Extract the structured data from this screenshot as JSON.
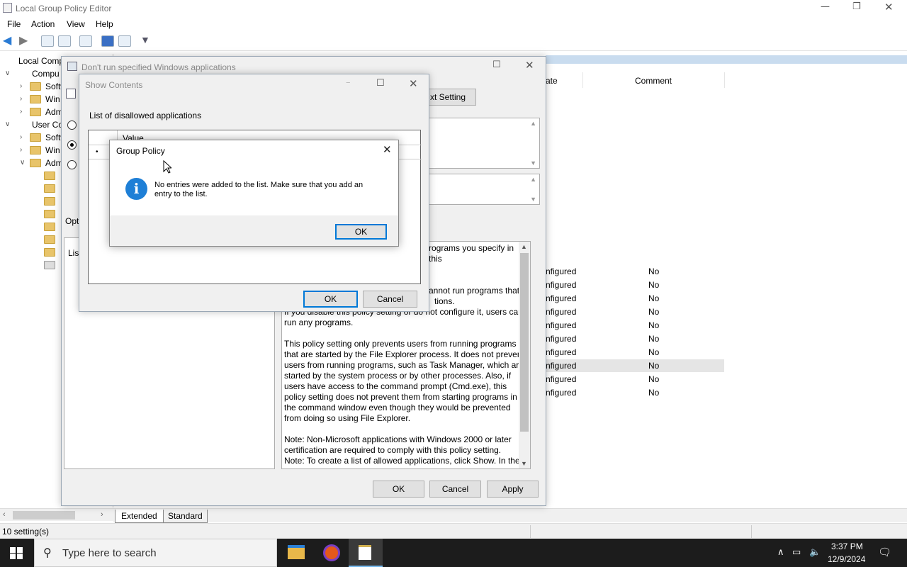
{
  "main": {
    "title": "Local Group Policy Editor",
    "menu": [
      "File",
      "Action",
      "View",
      "Help"
    ],
    "tree": [
      {
        "label": "Local Comp",
        "indent": 0
      },
      {
        "label": "Compu",
        "indent": 1
      },
      {
        "label": "Softw",
        "indent": 2
      },
      {
        "label": "Win",
        "indent": 2
      },
      {
        "label": "Adm",
        "indent": 2
      },
      {
        "label": "User Co",
        "indent": 1
      },
      {
        "label": "Softw",
        "indent": 2
      },
      {
        "label": "Win",
        "indent": 2
      },
      {
        "label": "Adm",
        "indent": 2
      }
    ],
    "columns": {
      "state": "ate",
      "comment": "Comment"
    },
    "rows": [
      {
        "state": "nfigured",
        "comment": "No"
      },
      {
        "state": "nfigured",
        "comment": "No"
      },
      {
        "state": "nfigured",
        "comment": "No"
      },
      {
        "state": "nfigured",
        "comment": "No"
      },
      {
        "state": "nfigured",
        "comment": "No"
      },
      {
        "state": "nfigured",
        "comment": "No"
      },
      {
        "state": "nfigured",
        "comment": "No"
      },
      {
        "state": "nfigured",
        "comment": "No"
      },
      {
        "state": "nfigured",
        "comment": "No"
      },
      {
        "state": "nfigured",
        "comment": "No"
      }
    ],
    "tabs": [
      "Extended",
      "Standard"
    ],
    "status": "10 setting(s)"
  },
  "policy": {
    "title": "Don't run specified Windows applications",
    "next_setting": "xt Setting",
    "options_label": "Opt",
    "list_label": "List",
    "help_head": "rograms you specify in this",
    "help_text": [
      "annot run programs that",
      "tions.",
      "If you disable this policy setting or do not configure it, users can",
      "run any programs.",
      "",
      "This policy setting only prevents users from running programs",
      "that are started by the File Explorer process. It does not prevent",
      "users from running programs, such as Task Manager, which are",
      "started by the system process or by other processes.  Also, if",
      "users have access to the command prompt (Cmd.exe), this",
      "policy setting does not prevent them from starting programs in",
      "the command window even though they would be prevented",
      "from doing so using File Explorer.",
      "",
      "Note: Non-Microsoft applications with Windows 2000 or later",
      "certification are required to comply with this policy setting.",
      "Note: To create a list of allowed applications, click Show.  In the"
    ],
    "ok": "OK",
    "cancel": "Cancel",
    "apply": "Apply"
  },
  "show": {
    "title": "Show Contents",
    "list_label": "List of disallowed applications",
    "col_value": "Value",
    "ok": "OK",
    "cancel": "Cancel"
  },
  "msg": {
    "title": "Group Policy",
    "text_line1": "No entries were added to the list. Make sure that you add an",
    "text_line2": "entry to the list.",
    "ok": "OK"
  },
  "taskbar": {
    "search_placeholder": "Type here to search",
    "time": "3:37 PM",
    "date": "12/9/2024"
  },
  "colors": {
    "accent": "#0078d7",
    "info": "#1e7fd6",
    "taskbar": "#1c1c1c"
  }
}
